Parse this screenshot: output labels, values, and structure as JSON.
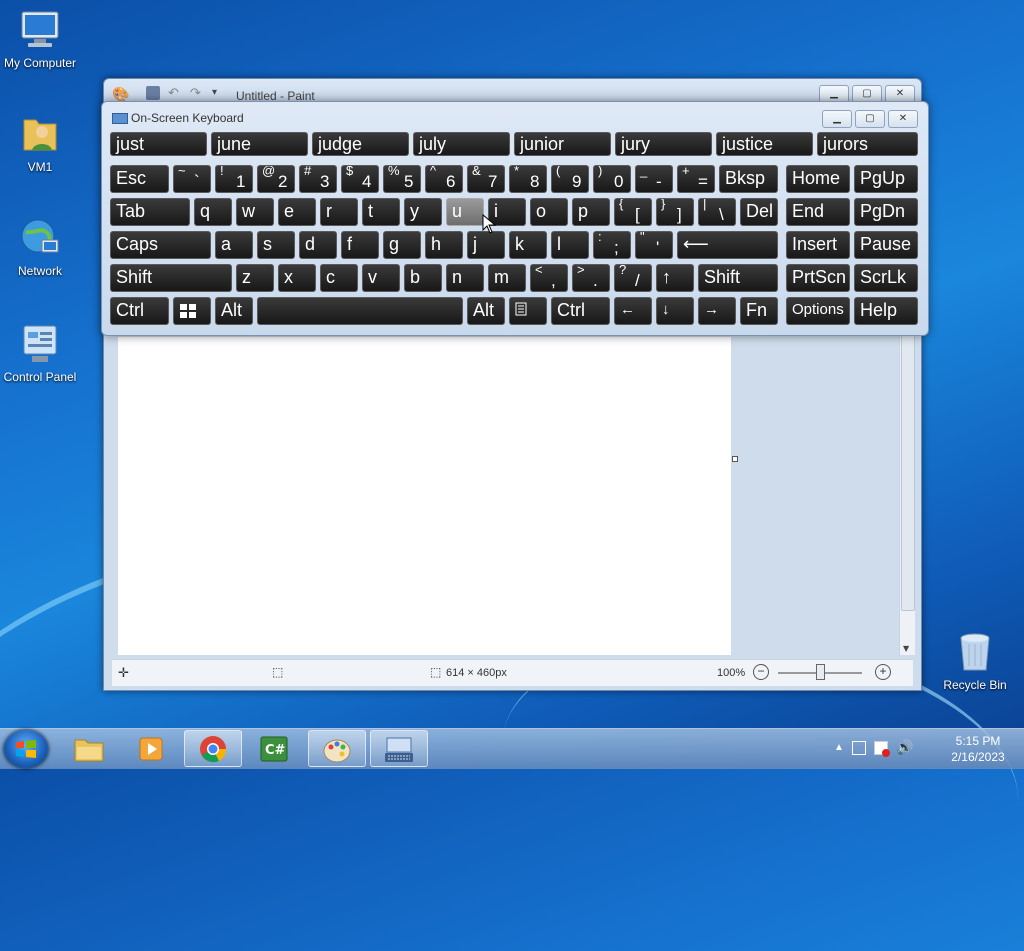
{
  "desktop": {
    "icons": [
      {
        "label": "My Computer",
        "icon": "computer-icon"
      },
      {
        "label": "VM1",
        "icon": "user-folder-icon"
      },
      {
        "label": "Network",
        "icon": "network-globe-icon"
      },
      {
        "label": "Control Panel",
        "icon": "control-panel-icon"
      },
      {
        "label": "Recycle Bin",
        "icon": "recycle-bin-icon"
      }
    ]
  },
  "paint": {
    "title": "Untitled - Paint",
    "status": {
      "size": "614 × 460px",
      "zoom": "100%"
    }
  },
  "osk": {
    "title": "On-Screen Keyboard",
    "predictions": [
      "just",
      "june",
      "judge",
      "july",
      "junior",
      "jury",
      "justice",
      "jurors"
    ],
    "keys": {
      "esc": "Esc",
      "tilde_sh": "~",
      "tilde": "`",
      "k1_sh": "!",
      "k1": "1",
      "k2_sh": "@",
      "k2": "2",
      "k3_sh": "#",
      "k3": "3",
      "k4_sh": "$",
      "k4": "4",
      "k5_sh": "%",
      "k5": "5",
      "k6_sh": "^",
      "k6": "6",
      "k7_sh": "&",
      "k7": "7",
      "k8_sh": "*",
      "k8": "8",
      "k9_sh": "(",
      "k9": "9",
      "k0_sh": ")",
      "k0": "0",
      "minus_sh": "_",
      "minus": "-",
      "eq_sh": "+",
      "eq": "=",
      "bksp": "Bksp",
      "home": "Home",
      "pgup": "PgUp",
      "tab": "Tab",
      "q": "q",
      "w": "w",
      "e": "e",
      "r": "r",
      "t": "t",
      "y": "y",
      "u": "u",
      "i": "i",
      "o": "o",
      "p": "p",
      "lb_sh": "{",
      "lb": "[",
      "rb_sh": "}",
      "rb": "]",
      "bs_sh": "|",
      "bs": "\\",
      "del": "Del",
      "end": "End",
      "pgdn": "PgDn",
      "caps": "Caps",
      "a": "a",
      "s": "s",
      "d": "d",
      "f": "f",
      "g": "g",
      "h": "h",
      "j": "j",
      "k": "k",
      "l": "l",
      "semi_sh": ":",
      "semi": ";",
      "quote_sh": "\"",
      "quote": "'",
      "enter": "⟵",
      "insert": "Insert",
      "pause": "Pause",
      "shift": "Shift",
      "z": "z",
      "x": "x",
      "c": "c",
      "v": "v",
      "b": "b",
      "n": "n",
      "m": "m",
      "comma_sh": "<",
      "comma": ",",
      "dot_sh": ">",
      "dot": ".",
      "slash_sh": "?",
      "slash": "/",
      "up": "↑",
      "shift_r": "Shift",
      "prtscn": "PrtScn",
      "scrlk": "ScrLk",
      "ctrl": "Ctrl",
      "alt": "Alt",
      "alt_r": "Alt",
      "ctrl_r": "Ctrl",
      "left": "←",
      "down": "↓",
      "right": "→",
      "fn": "Fn",
      "options": "Options",
      "help": "Help"
    }
  },
  "taskbar": {
    "time": "5:15 PM",
    "date": "2/16/2023"
  }
}
